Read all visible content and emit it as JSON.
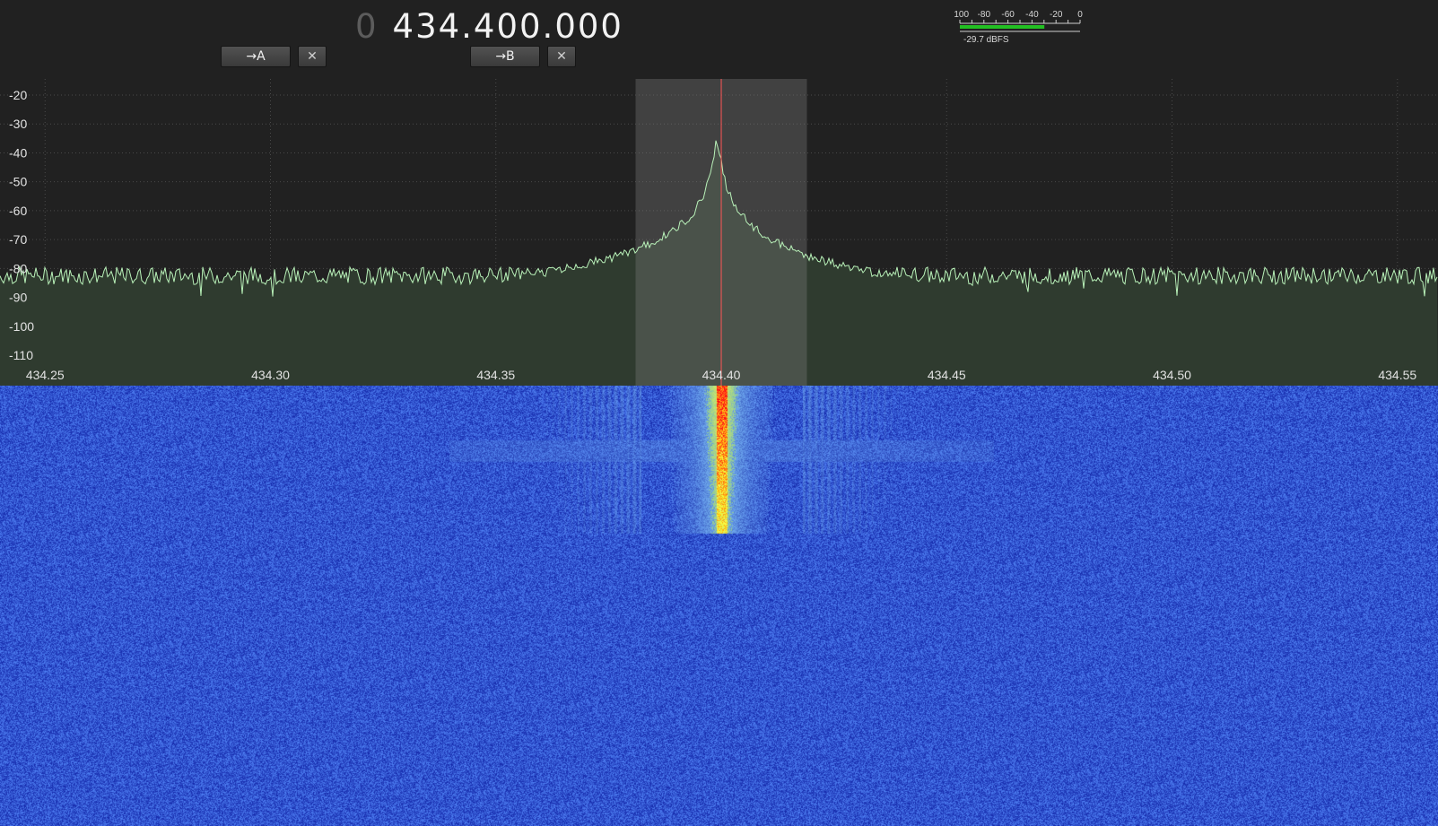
{
  "frequency_display": {
    "lead_digit": "0",
    "value": "434.400.000"
  },
  "vfo_buttons": {
    "to_a_label": "→A",
    "clear_a_label": "✕",
    "to_b_label": "→B",
    "clear_b_label": "✕"
  },
  "level_meter": {
    "scale_labels": [
      "-100",
      "-80",
      "-60",
      "-40",
      "-20",
      "0"
    ],
    "scale_min": -100,
    "scale_max": 0,
    "level_dbfs": -29.7,
    "readout": "-29.7 dBFS",
    "bar_color": "#22c022"
  },
  "chart_data": {
    "type": "line",
    "x_tick_labels": [
      "434.25",
      "434.30",
      "434.35",
      "434.40",
      "434.45",
      "434.50",
      "434.55"
    ],
    "x_ticks": [
      434.25,
      434.3,
      434.35,
      434.4,
      434.45,
      434.5,
      434.55
    ],
    "y_tick_labels": [
      "-20",
      "-30",
      "-40",
      "-50",
      "-60",
      "-70",
      "-80",
      "-90",
      "-100",
      "-110"
    ],
    "y_ticks": [
      -20,
      -30,
      -40,
      -50,
      -60,
      -70,
      -80,
      -90,
      -100,
      -110
    ],
    "xlim": [
      434.24,
      434.559
    ],
    "ylim": [
      -115,
      -15
    ],
    "noise_floor_db": -82.5,
    "noise_jitter_db": 3,
    "peak": {
      "x": 434.399,
      "y": -35
    },
    "shoulders": [
      {
        "x": 434.38,
        "y": -74
      },
      {
        "x": 434.42,
        "y": -76
      }
    ],
    "passband": [
      434.381,
      434.419
    ],
    "tuned_frequency": 434.4,
    "grid": true,
    "colors": {
      "trace": "#b9f2b9",
      "fill": "#2f3b2f",
      "passband": "#7f7f7f",
      "marker": "#ff5555",
      "grid": "#4a4a4a"
    }
  },
  "waterfall": {
    "signal_center": 434.4,
    "colors": {
      "background": "#2744d6",
      "signal_low": "#6fa8e8",
      "signal_mid": "#ffff33",
      "signal_high": "#ff3300"
    }
  }
}
